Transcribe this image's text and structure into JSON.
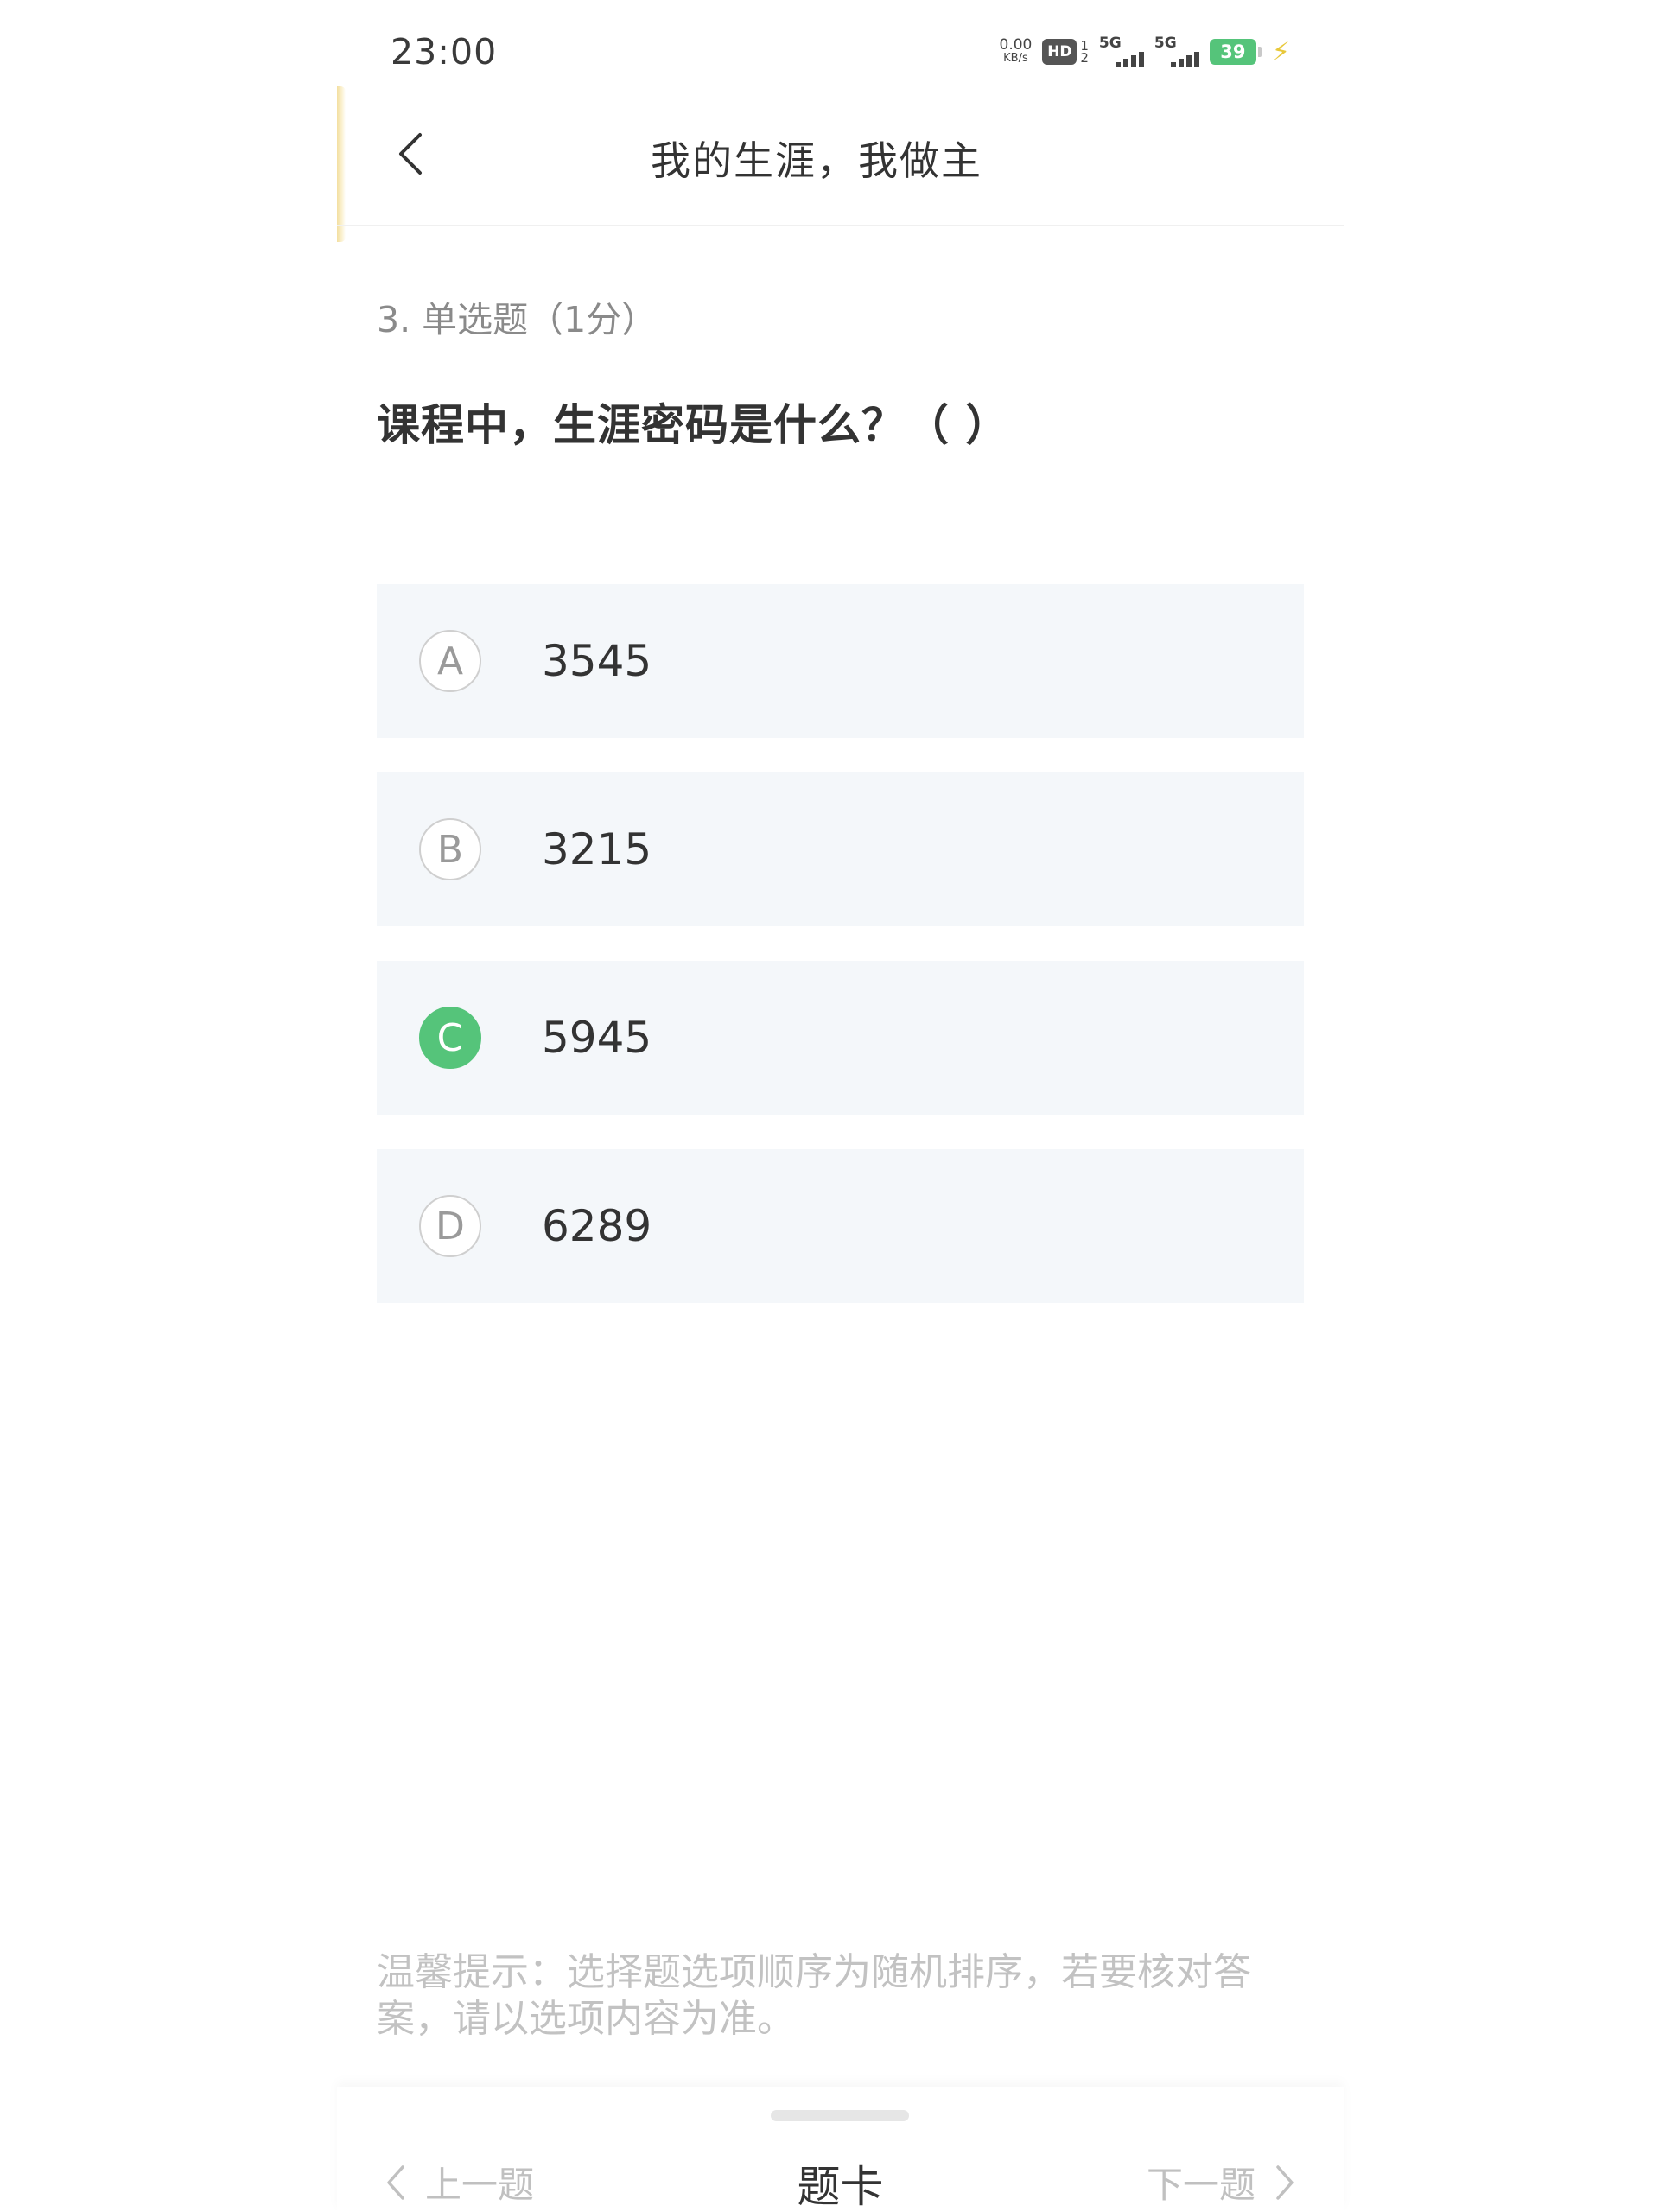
{
  "status_bar": {
    "time": "23:00",
    "net_speed_value": "0.00",
    "net_speed_unit": "KB/s",
    "hd_label": "HD",
    "hd_sub_top": "1",
    "hd_sub_bottom": "2",
    "sim1_label": "5G",
    "sim2_label": "5G",
    "battery_level": "39",
    "icons": [
      "net-speed",
      "hd-volte-icon",
      "signal-icon",
      "signal-icon",
      "battery-icon",
      "charging-bolt-icon"
    ]
  },
  "header": {
    "title": "我的生涯，我做主",
    "back_icon": "chevron-left-icon"
  },
  "question": {
    "type_label": "3. 单选题（1分）",
    "text": "课程中，生涯密码是什么？（  ）"
  },
  "options": [
    {
      "letter": "A",
      "text": "3545",
      "selected": false
    },
    {
      "letter": "B",
      "text": "3215",
      "selected": false
    },
    {
      "letter": "C",
      "text": "5945",
      "selected": true
    },
    {
      "letter": "D",
      "text": "6289",
      "selected": false
    }
  ],
  "tip": {
    "line1": "温馨提示：选择题选项顺序为随机排序，若要核对答",
    "line2": "案，请以选项内容为准。"
  },
  "bottom_bar": {
    "prev_label": "上一题",
    "card_label": "题卡",
    "next_label": "下一题"
  },
  "colors": {
    "accent_green": "#55c47a",
    "option_bg": "#f4f7fa",
    "text_primary": "#333333",
    "text_muted": "#c0c0c0"
  }
}
